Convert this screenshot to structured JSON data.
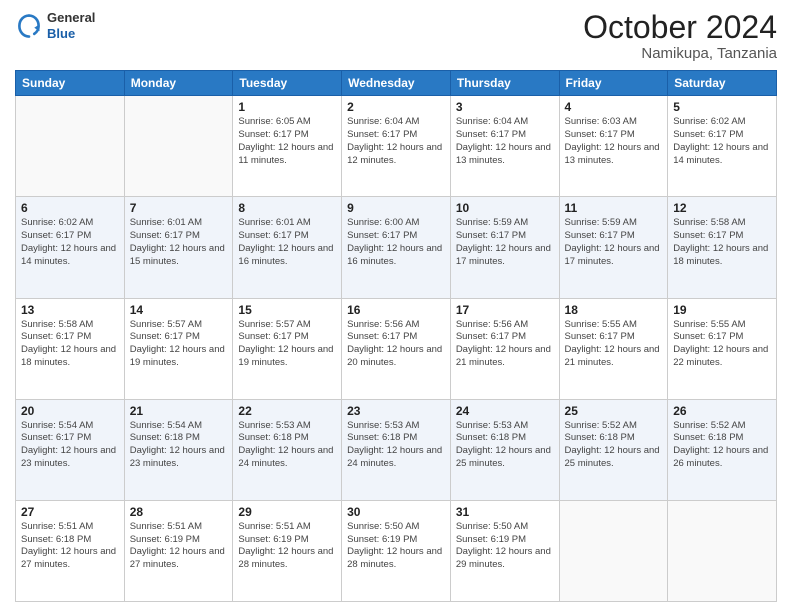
{
  "header": {
    "logo_general": "General",
    "logo_blue": "Blue",
    "month": "October 2024",
    "location": "Namikupa, Tanzania"
  },
  "weekdays": [
    "Sunday",
    "Monday",
    "Tuesday",
    "Wednesday",
    "Thursday",
    "Friday",
    "Saturday"
  ],
  "weeks": [
    [
      {
        "day": "",
        "info": ""
      },
      {
        "day": "",
        "info": ""
      },
      {
        "day": "1",
        "info": "Sunrise: 6:05 AM\nSunset: 6:17 PM\nDaylight: 12 hours\nand 11 minutes."
      },
      {
        "day": "2",
        "info": "Sunrise: 6:04 AM\nSunset: 6:17 PM\nDaylight: 12 hours\nand 12 minutes."
      },
      {
        "day": "3",
        "info": "Sunrise: 6:04 AM\nSunset: 6:17 PM\nDaylight: 12 hours\nand 13 minutes."
      },
      {
        "day": "4",
        "info": "Sunrise: 6:03 AM\nSunset: 6:17 PM\nDaylight: 12 hours\nand 13 minutes."
      },
      {
        "day": "5",
        "info": "Sunrise: 6:02 AM\nSunset: 6:17 PM\nDaylight: 12 hours\nand 14 minutes."
      }
    ],
    [
      {
        "day": "6",
        "info": "Sunrise: 6:02 AM\nSunset: 6:17 PM\nDaylight: 12 hours\nand 14 minutes."
      },
      {
        "day": "7",
        "info": "Sunrise: 6:01 AM\nSunset: 6:17 PM\nDaylight: 12 hours\nand 15 minutes."
      },
      {
        "day": "8",
        "info": "Sunrise: 6:01 AM\nSunset: 6:17 PM\nDaylight: 12 hours\nand 16 minutes."
      },
      {
        "day": "9",
        "info": "Sunrise: 6:00 AM\nSunset: 6:17 PM\nDaylight: 12 hours\nand 16 minutes."
      },
      {
        "day": "10",
        "info": "Sunrise: 5:59 AM\nSunset: 6:17 PM\nDaylight: 12 hours\nand 17 minutes."
      },
      {
        "day": "11",
        "info": "Sunrise: 5:59 AM\nSunset: 6:17 PM\nDaylight: 12 hours\nand 17 minutes."
      },
      {
        "day": "12",
        "info": "Sunrise: 5:58 AM\nSunset: 6:17 PM\nDaylight: 12 hours\nand 18 minutes."
      }
    ],
    [
      {
        "day": "13",
        "info": "Sunrise: 5:58 AM\nSunset: 6:17 PM\nDaylight: 12 hours\nand 18 minutes."
      },
      {
        "day": "14",
        "info": "Sunrise: 5:57 AM\nSunset: 6:17 PM\nDaylight: 12 hours\nand 19 minutes."
      },
      {
        "day": "15",
        "info": "Sunrise: 5:57 AM\nSunset: 6:17 PM\nDaylight: 12 hours\nand 19 minutes."
      },
      {
        "day": "16",
        "info": "Sunrise: 5:56 AM\nSunset: 6:17 PM\nDaylight: 12 hours\nand 20 minutes."
      },
      {
        "day": "17",
        "info": "Sunrise: 5:56 AM\nSunset: 6:17 PM\nDaylight: 12 hours\nand 21 minutes."
      },
      {
        "day": "18",
        "info": "Sunrise: 5:55 AM\nSunset: 6:17 PM\nDaylight: 12 hours\nand 21 minutes."
      },
      {
        "day": "19",
        "info": "Sunrise: 5:55 AM\nSunset: 6:17 PM\nDaylight: 12 hours\nand 22 minutes."
      }
    ],
    [
      {
        "day": "20",
        "info": "Sunrise: 5:54 AM\nSunset: 6:17 PM\nDaylight: 12 hours\nand 23 minutes."
      },
      {
        "day": "21",
        "info": "Sunrise: 5:54 AM\nSunset: 6:18 PM\nDaylight: 12 hours\nand 23 minutes."
      },
      {
        "day": "22",
        "info": "Sunrise: 5:53 AM\nSunset: 6:18 PM\nDaylight: 12 hours\nand 24 minutes."
      },
      {
        "day": "23",
        "info": "Sunrise: 5:53 AM\nSunset: 6:18 PM\nDaylight: 12 hours\nand 24 minutes."
      },
      {
        "day": "24",
        "info": "Sunrise: 5:53 AM\nSunset: 6:18 PM\nDaylight: 12 hours\nand 25 minutes."
      },
      {
        "day": "25",
        "info": "Sunrise: 5:52 AM\nSunset: 6:18 PM\nDaylight: 12 hours\nand 25 minutes."
      },
      {
        "day": "26",
        "info": "Sunrise: 5:52 AM\nSunset: 6:18 PM\nDaylight: 12 hours\nand 26 minutes."
      }
    ],
    [
      {
        "day": "27",
        "info": "Sunrise: 5:51 AM\nSunset: 6:18 PM\nDaylight: 12 hours\nand 27 minutes."
      },
      {
        "day": "28",
        "info": "Sunrise: 5:51 AM\nSunset: 6:19 PM\nDaylight: 12 hours\nand 27 minutes."
      },
      {
        "day": "29",
        "info": "Sunrise: 5:51 AM\nSunset: 6:19 PM\nDaylight: 12 hours\nand 28 minutes."
      },
      {
        "day": "30",
        "info": "Sunrise: 5:50 AM\nSunset: 6:19 PM\nDaylight: 12 hours\nand 28 minutes."
      },
      {
        "day": "31",
        "info": "Sunrise: 5:50 AM\nSunset: 6:19 PM\nDaylight: 12 hours\nand 29 minutes."
      },
      {
        "day": "",
        "info": ""
      },
      {
        "day": "",
        "info": ""
      }
    ]
  ]
}
